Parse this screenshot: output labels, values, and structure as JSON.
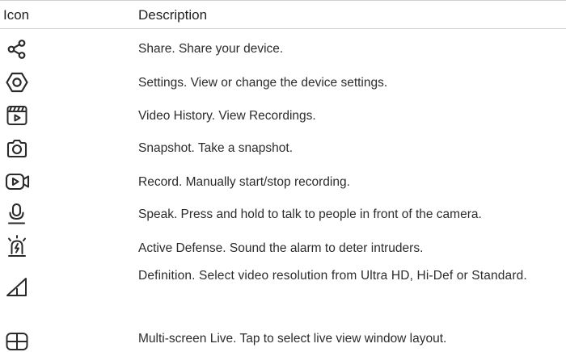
{
  "table": {
    "headers": {
      "icon": "Icon",
      "description": "Description"
    },
    "rows": [
      {
        "icon": "share-icon",
        "description": "Share. Share your device."
      },
      {
        "icon": "settings-icon",
        "description": "Settings. View or change the device settings."
      },
      {
        "icon": "video-history-icon",
        "description": "Video History. View Recordings."
      },
      {
        "icon": "snapshot-camera-icon",
        "description": "Snapshot. Take a snapshot."
      },
      {
        "icon": "record-video-icon",
        "description": "Record. Manually start/stop recording."
      },
      {
        "icon": "microphone-icon",
        "description": "Speak. Press and hold to talk to people in front of the camera."
      },
      {
        "icon": "alarm-siren-icon",
        "description": "Active Defense. Sound the alarm to deter intruders."
      },
      {
        "icon": "signal-definition-icon",
        "description": "Definition. Select video resolution from Ultra HD, Hi-Def or Standard."
      },
      {
        "icon": "multi-screen-layout-icon",
        "description": "Multi-screen Live. Tap to select live view window layout."
      }
    ]
  }
}
